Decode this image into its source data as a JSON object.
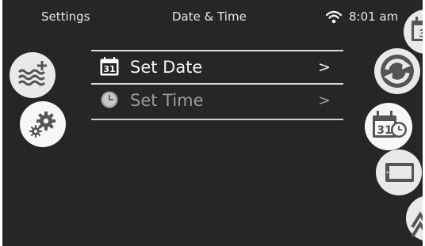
{
  "header": {
    "back_label": "Settings",
    "title": "Date & Time",
    "time": "8:01 am",
    "wifi_icon": "wifi-icon"
  },
  "menu": {
    "items": [
      {
        "label": "Set Date",
        "arrow": ">",
        "icon": "calendar-icon",
        "calendar_day": "31",
        "enabled": true
      },
      {
        "label": "Set Time",
        "arrow": ">",
        "icon": "clock-icon",
        "enabled": false
      }
    ]
  },
  "left_nav": [
    {
      "name": "water-care",
      "icon": "water-plus-icon"
    },
    {
      "name": "settings",
      "icon": "gears-icon",
      "selected": true
    }
  ],
  "right_nav": [
    {
      "name": "schedule",
      "icon": "calendar-icon"
    },
    {
      "name": "reset",
      "icon": "refresh-icon"
    },
    {
      "name": "date-time",
      "icon": "calendar-clock-icon",
      "calendar_day": "31",
      "selected": true
    },
    {
      "name": "display",
      "icon": "tablet-icon"
    },
    {
      "name": "more",
      "icon": "arrows-icon"
    }
  ],
  "colors": {
    "background": "#262626",
    "button": "#e9e9e9",
    "text_primary": "#f4f4f4",
    "text_disabled": "#9b9b9b",
    "icon_dark": "#555555"
  }
}
